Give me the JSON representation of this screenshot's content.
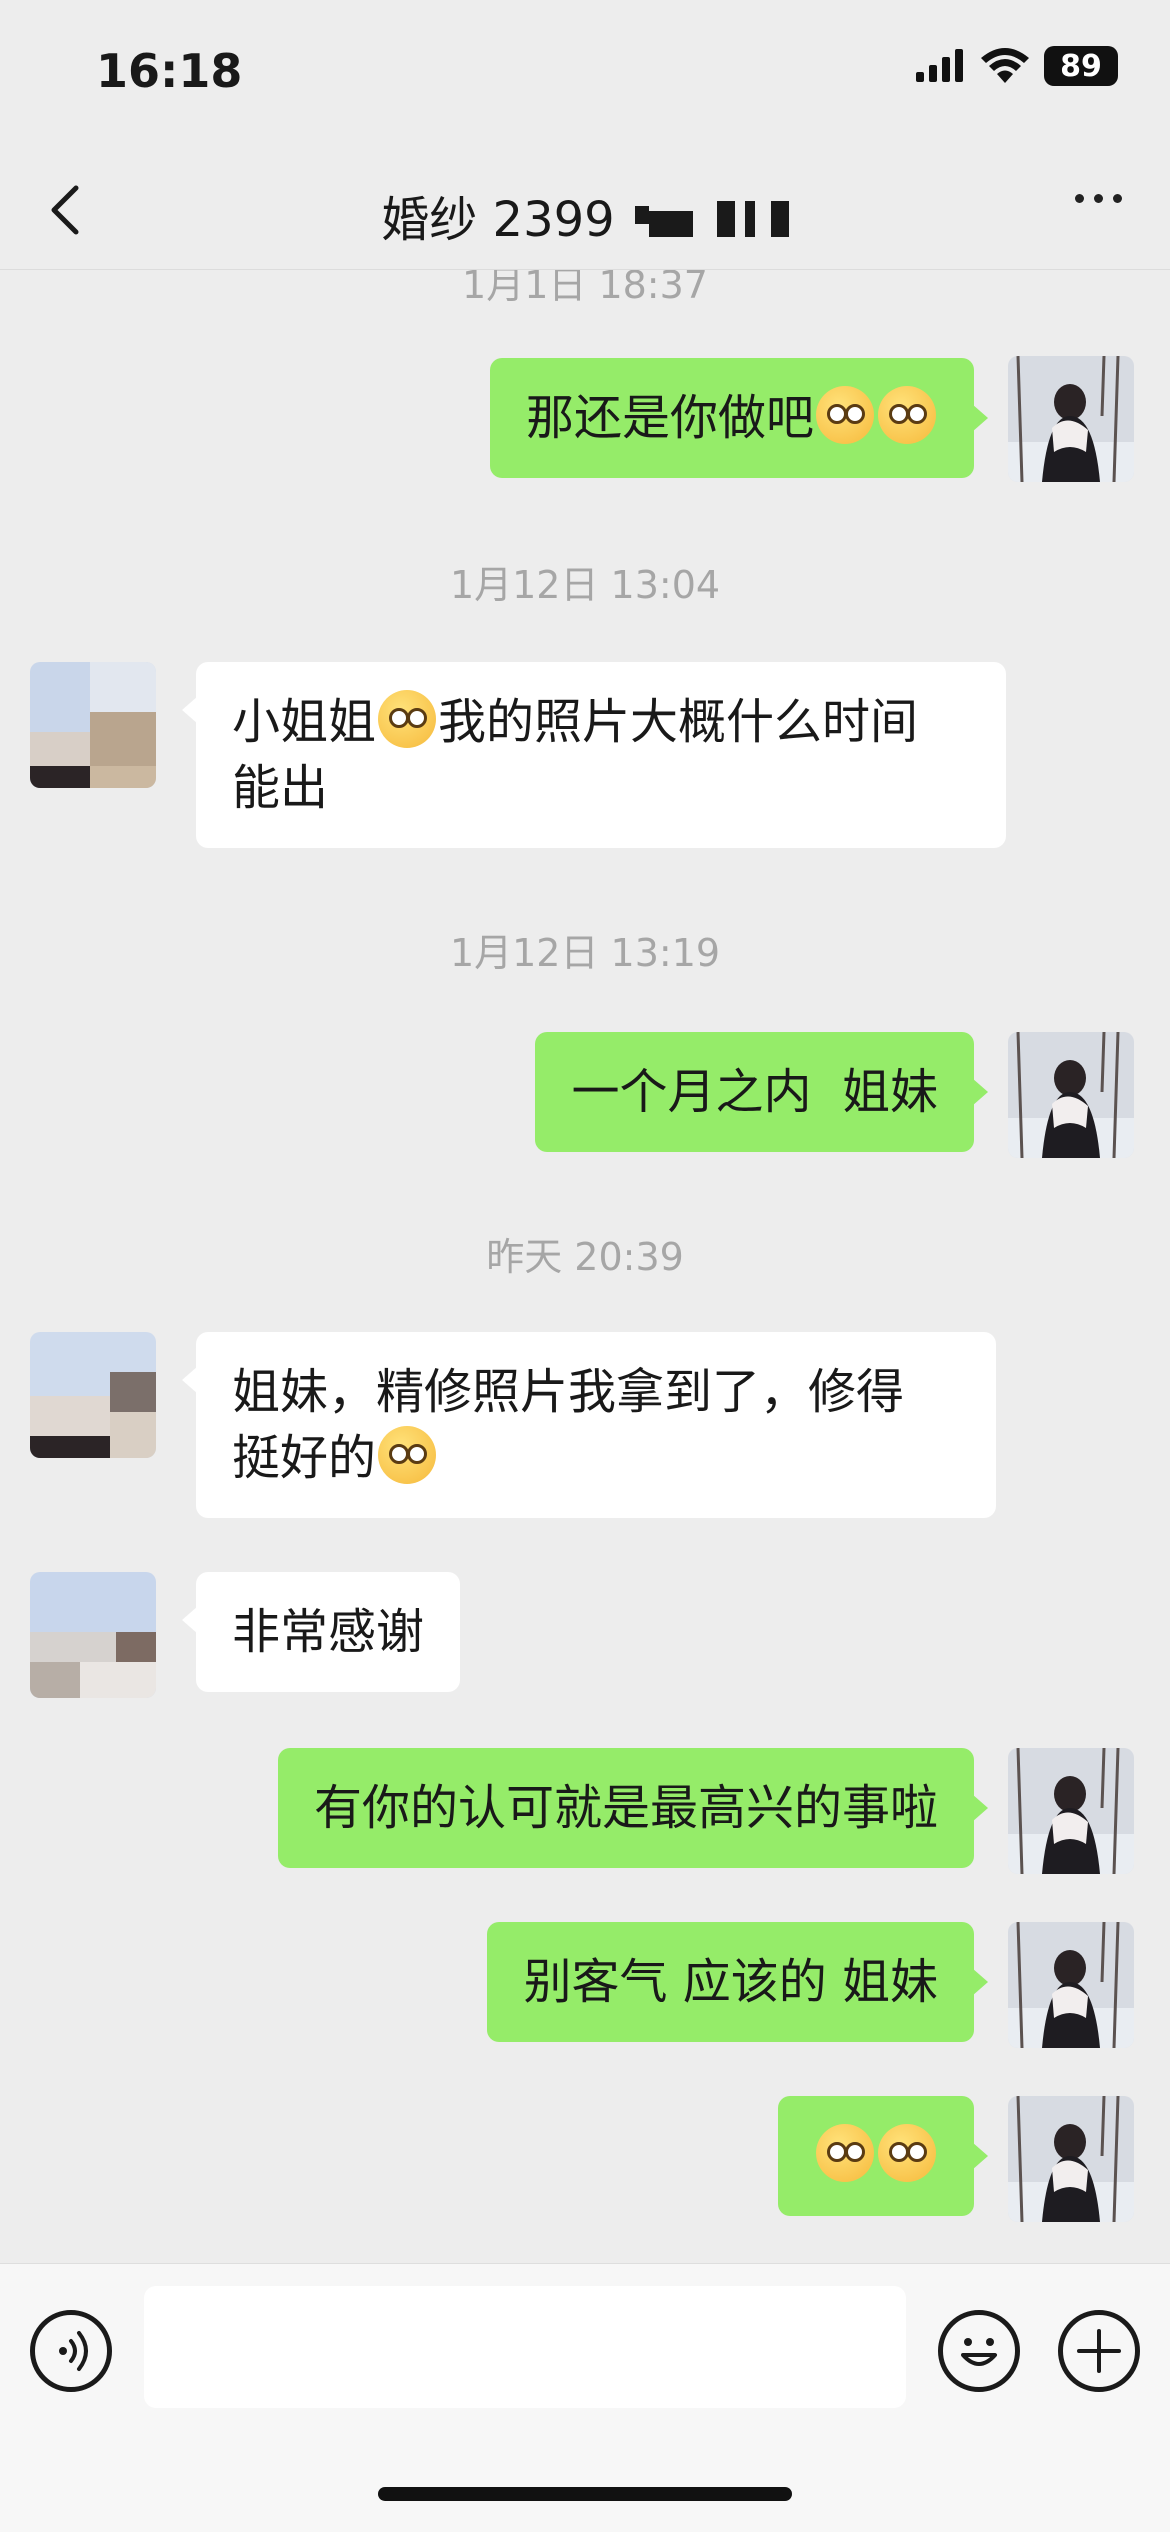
{
  "status_bar": {
    "time": "16:18",
    "battery": "89"
  },
  "header": {
    "title": "婚纱 2399"
  },
  "messages": [
    {
      "type": "timestamp",
      "text": "1月1日 18:37"
    },
    {
      "type": "self",
      "text": "那还是你做吧",
      "emoji": [
        "facepalm-laugh",
        "facepalm-laugh"
      ]
    },
    {
      "type": "timestamp",
      "text": "1月12日 13:04"
    },
    {
      "type": "other",
      "lines": [
        "小姐姐",
        "我的照片大概什么时间",
        "能出"
      ],
      "emoji": [
        "thinking-face"
      ]
    },
    {
      "type": "timestamp",
      "text": "1月12日 13:19"
    },
    {
      "type": "self",
      "text": "一个月之内  姐妹"
    },
    {
      "type": "timestamp",
      "text": "昨天 20:39"
    },
    {
      "type": "other",
      "lines": [
        "姐妹，精修照片我拿到了，修得",
        "挺好的"
      ],
      "emoji": [
        "thinking-face"
      ]
    },
    {
      "type": "other",
      "text": "非常感谢"
    },
    {
      "type": "self",
      "text": "有你的认可就是最高兴的事啦"
    },
    {
      "type": "self",
      "text": "别客气 应该的 姐妹"
    },
    {
      "type": "self",
      "emoji": [
        "thinking-face",
        "thinking-face"
      ]
    }
  ],
  "input_bar": {
    "voice_icon": "voice-icon",
    "emoji_icon": "emoji-face-icon",
    "plus_icon": "plus-icon",
    "placeholder": ""
  },
  "colors": {
    "background": "#ededed",
    "self_bubble": "#95ec69",
    "other_bubble": "#ffffff",
    "timestamp": "#a6a6a6"
  }
}
